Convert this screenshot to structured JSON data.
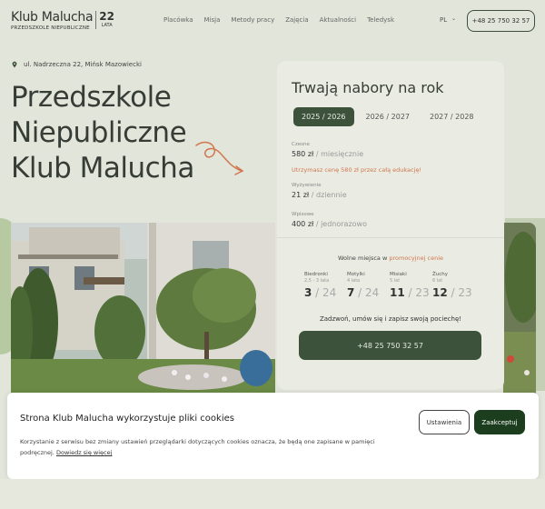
{
  "logo": {
    "name": "Klub Malucha",
    "subtitle": "PRZEDSZKOLE NIEPUBLICZNE",
    "years": "22",
    "years_label": "LATA"
  },
  "nav": {
    "items": [
      "Placówka",
      "Misja",
      "Metody pracy",
      "Zajęcia",
      "Aktualności",
      "Teledysk"
    ]
  },
  "lang": {
    "current": "PL"
  },
  "header_phone": "+48 25 750 32 57",
  "hero": {
    "address": "ul. Nadrzeczna 22, Mińsk Mazowiecki",
    "title_lines": [
      "Przedszkole",
      "Niepubliczne",
      "Klub Malucha"
    ]
  },
  "enrollment": {
    "title": "Trwają nabory na rok",
    "tabs": [
      "2025 / 2026",
      "2026 / 2027",
      "2027 / 2028"
    ],
    "active_tab": "2025 / 2026",
    "prices": [
      {
        "label": "Czesne",
        "amount": "580 zł",
        "unit": "/ miesięcznie"
      },
      {
        "label": "Wyżywienie",
        "amount": "21 zł",
        "unit": "/ dziennie"
      },
      {
        "label": "Wpisowe",
        "amount": "400 zł",
        "unit": "/ jednorazowo"
      }
    ],
    "discount_note": "Utrzymasz cenę 580 zł przez całą edukację!",
    "free_places_prefix": "Wolne miejsca w",
    "free_places_highlight": "promocyjnej cenie",
    "groups": [
      {
        "name": "Biedronki",
        "age": "2,5 - 3 lata",
        "free": "3",
        "total": "24"
      },
      {
        "name": "Motylki",
        "age": "4 lata",
        "free": "7",
        "total": "24"
      },
      {
        "name": "Misiaki",
        "age": "5 lat",
        "free": "11",
        "total": "23"
      },
      {
        "name": "Żuchy",
        "age": "6 lat",
        "free": "12",
        "total": "23"
      }
    ],
    "cta_text": "Zadzwoń, umów się i zapisz swoją pociechę!",
    "cta_phone": "+48 25 750 32 57"
  },
  "cookies": {
    "title": "Strona Klub Malucha wykorzystuje pliki cookies",
    "text": "Korzystanie z serwisu bez zmiany ustawień przeglądarki dotyczących cookies oznacza, że będą one zapisane w pamięci podręcznej.",
    "link": "Dowiedz się więcej",
    "settings_label": "Ustawienia",
    "accept_label": "Zaakceptuj"
  },
  "colors": {
    "brand_green": "#3c523a",
    "accent_orange": "#d0774f",
    "accept_green": "#1c3e1e"
  }
}
